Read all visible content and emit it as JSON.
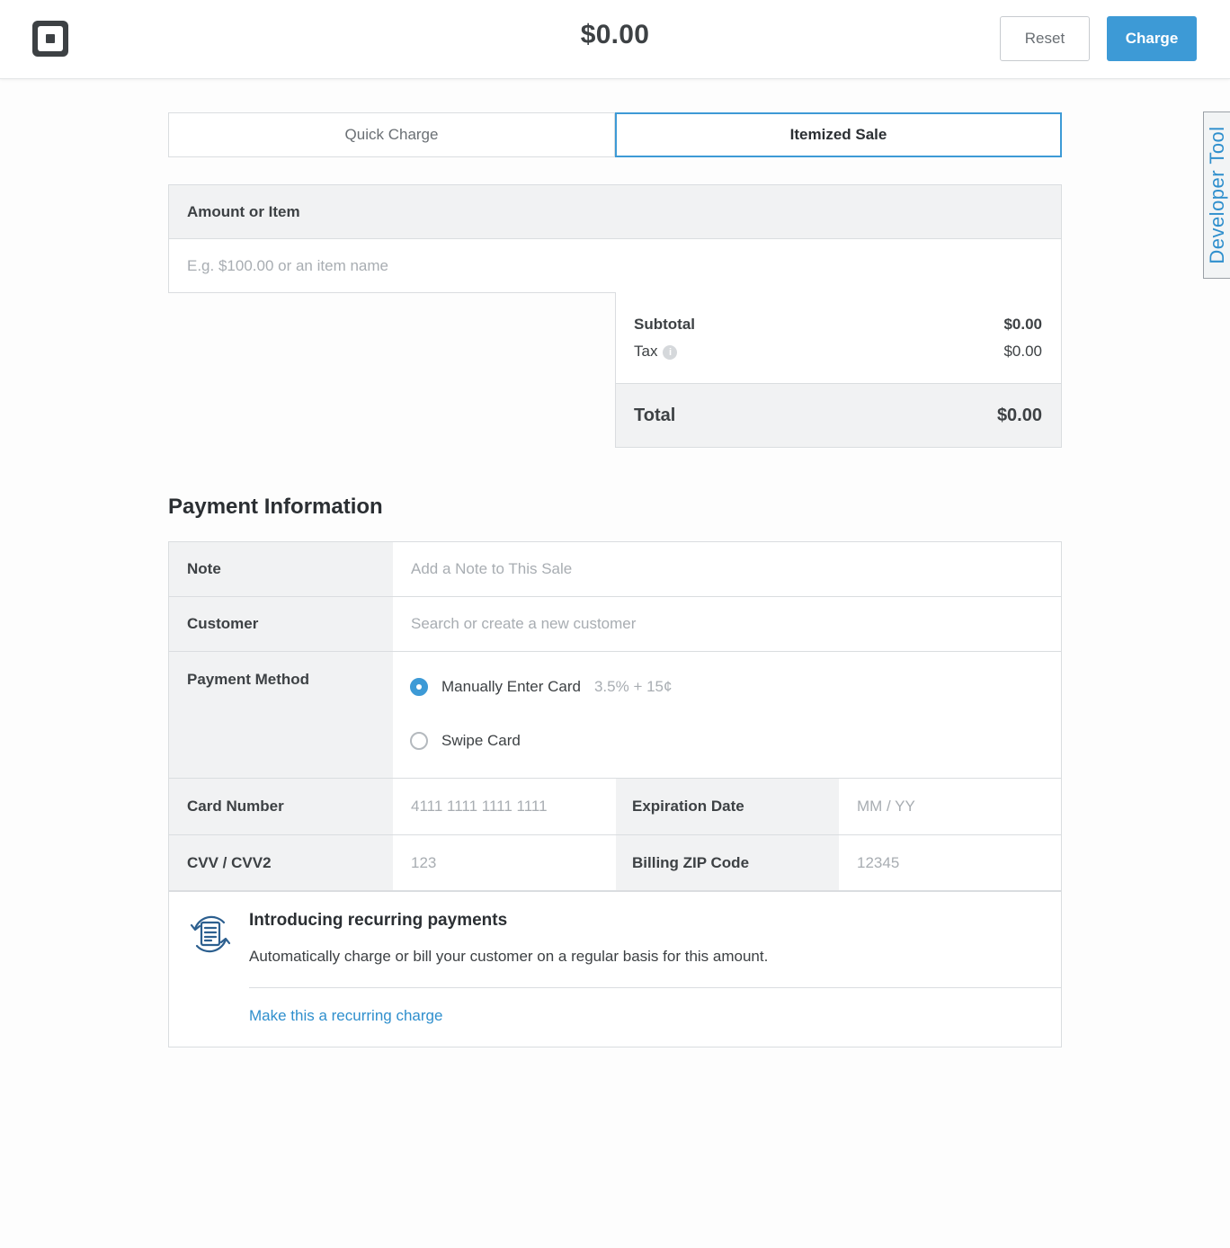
{
  "header": {
    "amount": "$0.00",
    "reset_label": "Reset",
    "charge_label": "Charge"
  },
  "developer_tool": {
    "label": "Developer Tool"
  },
  "tabs": [
    {
      "label": "Quick Charge",
      "active": false
    },
    {
      "label": "Itemized Sale",
      "active": true
    }
  ],
  "amount_item": {
    "heading": "Amount or Item",
    "placeholder": "E.g. $100.00 or an item name"
  },
  "summary": {
    "subtotal_label": "Subtotal",
    "subtotal_value": "$0.00",
    "tax_label": "Tax",
    "tax_value": "$0.00",
    "total_label": "Total",
    "total_value": "$0.00"
  },
  "payment": {
    "title": "Payment Information",
    "note_label": "Note",
    "note_placeholder": "Add a Note to This Sale",
    "customer_label": "Customer",
    "customer_placeholder": "Search or create a new customer",
    "method_label": "Payment Method",
    "methods": [
      {
        "label": "Manually Enter Card",
        "fee": "3.5% + 15¢",
        "selected": true
      },
      {
        "label": "Swipe Card",
        "fee": "",
        "selected": false
      }
    ],
    "card_number_label": "Card Number",
    "card_number_placeholder": "4111 1111 1111 1111",
    "expiration_label": "Expiration Date",
    "expiration_placeholder": "MM / YY",
    "cvv_label": "CVV / CVV2",
    "cvv_placeholder": "123",
    "zip_label": "Billing ZIP Code",
    "zip_placeholder": "12345"
  },
  "recurring": {
    "icon": "recurring-invoice-icon",
    "title": "Introducing recurring payments",
    "text": "Automatically charge or bill your customer on a regular basis for this amount.",
    "link": "Make this a recurring charge"
  },
  "colors": {
    "accent": "#3d9ad6",
    "link": "#2f8fcd",
    "label_bg": "#f1f2f3",
    "border": "#dadde0"
  }
}
